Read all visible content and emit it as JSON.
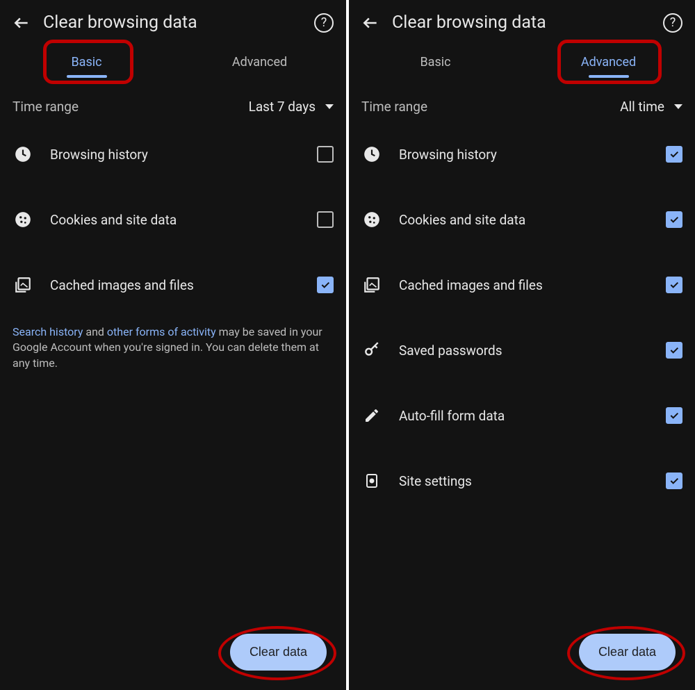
{
  "left": {
    "title": "Clear browsing data",
    "tabs": {
      "basic": "Basic",
      "advanced": "Advanced",
      "active": "basic"
    },
    "range": {
      "label": "Time range",
      "value": "Last 7 days"
    },
    "items": [
      {
        "icon": "clock-icon",
        "label": "Browsing history",
        "checked": false
      },
      {
        "icon": "cookie-icon",
        "label": "Cookies and site data",
        "checked": false
      },
      {
        "icon": "image-icon",
        "label": "Cached images and files",
        "checked": true
      }
    ],
    "footnote": {
      "link1": "Search history",
      "mid": " and ",
      "link2": "other forms of activity",
      "rest": " may be saved in your Google Account when you're signed in. You can delete them at any time."
    },
    "clear_label": "Clear data"
  },
  "right": {
    "title": "Clear browsing data",
    "tabs": {
      "basic": "Basic",
      "advanced": "Advanced",
      "active": "advanced"
    },
    "range": {
      "label": "Time range",
      "value": "All time"
    },
    "items": [
      {
        "icon": "clock-icon",
        "label": "Browsing history",
        "checked": true
      },
      {
        "icon": "cookie-icon",
        "label": "Cookies and site data",
        "checked": true
      },
      {
        "icon": "image-icon",
        "label": "Cached images and files",
        "checked": true
      },
      {
        "icon": "key-icon",
        "label": "Saved passwords",
        "checked": true
      },
      {
        "icon": "pencil-icon",
        "label": "Auto-fill form data",
        "checked": true
      },
      {
        "icon": "settings-page-icon",
        "label": "Site settings",
        "checked": true
      }
    ],
    "clear_label": "Clear data"
  }
}
